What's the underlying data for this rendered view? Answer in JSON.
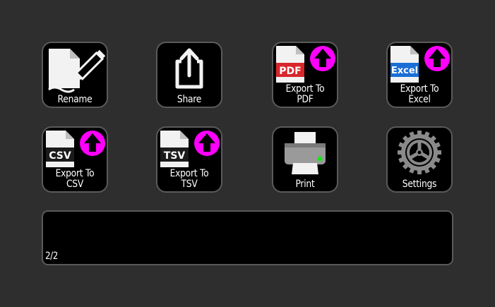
{
  "tiles": {
    "rename": {
      "label": "Rename"
    },
    "share": {
      "label": "Share"
    },
    "export_pdf": {
      "label": "Export To\nPDF",
      "badge": "PDF",
      "badge_color": "#d8262b"
    },
    "export_excel": {
      "label": "Export To\nExcel",
      "badge": "Excel",
      "badge_color": "#1a6fd6"
    },
    "export_csv": {
      "label": "Export To\nCSV",
      "badge": "CSV",
      "badge_color": "#1b1b1b"
    },
    "export_tsv": {
      "label": "Export To\nTSV",
      "badge": "TSV",
      "badge_color": "#1b1b1b"
    },
    "print": {
      "label": "Print"
    },
    "settings": {
      "label": "Settings"
    }
  },
  "status": {
    "page_indicator": "2/2"
  },
  "colors": {
    "background": "#2e2e2e",
    "tile_fill": "#000000",
    "tile_border": "#5a5a5a",
    "upload_arrow_circle": "#ff00ff",
    "printer_led": "#19e619"
  }
}
